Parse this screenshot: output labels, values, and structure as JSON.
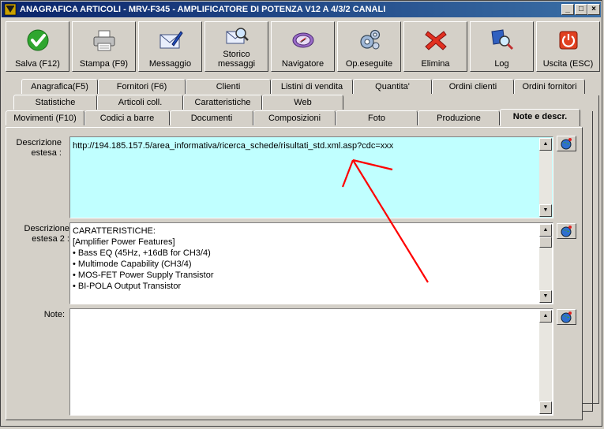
{
  "window": {
    "title": "ANAGRAFICA ARTICOLI - MRV-F345 - AMPLIFICATORE DI POTENZA  V12 A 4/3/2 CANALI",
    "controls": {
      "minimize": "_",
      "maximize": "□",
      "close": "×"
    }
  },
  "toolbar": [
    {
      "label": "Salva (F12)",
      "icon": "check-icon"
    },
    {
      "label": "Stampa (F9)",
      "icon": "printer-icon"
    },
    {
      "label": "Messaggio",
      "icon": "envelope-pen-icon"
    },
    {
      "label": "Storico\nmessaggi",
      "icon": "envelope-search-icon"
    },
    {
      "label": "Navigatore",
      "icon": "compass-icon"
    },
    {
      "label": "Op.eseguite",
      "icon": "gears-icon"
    },
    {
      "label": "Elimina",
      "icon": "delete-x-icon"
    },
    {
      "label": "Log",
      "icon": "log-search-icon"
    },
    {
      "label": "Uscita (ESC)",
      "icon": "power-icon"
    }
  ],
  "tabs": {
    "row1": [
      "Anagrafica(F5)",
      "Fornitori (F6)",
      "Clienti",
      "Listini di vendita",
      "Quantita'",
      "Ordini clienti",
      "Ordini fornitori"
    ],
    "row2": [
      "Statistiche",
      "Articoli coll.",
      "Caratteristiche",
      "Web"
    ],
    "row3": [
      "Movimenti (F10)",
      "Codici a barre",
      "Documenti",
      "Composizioni",
      "Foto",
      "Produzione",
      "Note e descr."
    ],
    "active": "Note e descr."
  },
  "fields": {
    "descrizione_estesa": {
      "label": "Descrizione\nestesa :",
      "value": "http://194.185.157.5/area_informativa/ricerca_schede/risultati_std.xml.asp?cdc=xxx",
      "bg": "#c0ffff"
    },
    "descrizione_estesa_2": {
      "label": "Descrizione\nestesa 2 :",
      "lines": [
        "CARATTERISTICHE:",
        "[Amplifier Power Features]",
        "• Bass EQ (45Hz, +16dB for CH3/4)",
        "• Multimode Capability (CH3/4)",
        "• MOS-FET Power Supply Transistor",
        "• BI-POLA Output Transistor"
      ]
    },
    "note": {
      "label": "Note:",
      "value": ""
    }
  },
  "annotation": {
    "color": "#ff0000"
  }
}
